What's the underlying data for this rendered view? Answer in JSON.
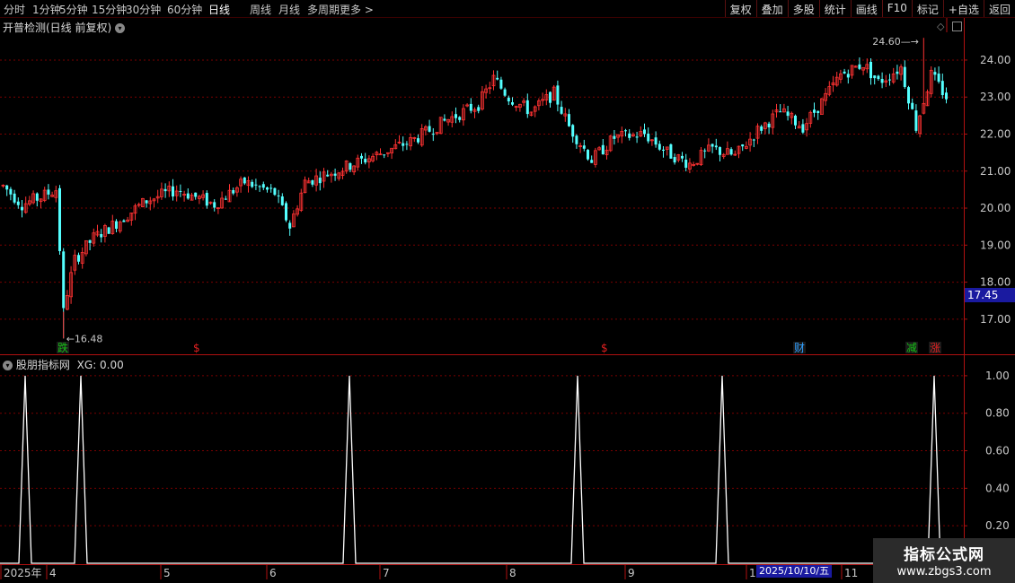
{
  "toolbar": {
    "periods": [
      "分时",
      "1分钟",
      "5分钟",
      "15分钟",
      "30分钟",
      "60分钟",
      "日线",
      "周线",
      "月线",
      "多周期",
      "更多 >"
    ],
    "active": "日线",
    "right_buttons": [
      "复权",
      "叠加",
      "多股",
      "统计",
      "画线",
      "F10",
      "标记",
      "+自选",
      "返回"
    ]
  },
  "main_panel": {
    "title": "开普检测(日线 前复权)",
    "price_axis": [
      "24.00",
      "23.00",
      "22.00",
      "21.00",
      "20.00",
      "19.00",
      "18.00",
      "17.00"
    ],
    "current_price": "17.45",
    "high_label": "24.60",
    "low_label": "16.48",
    "markers": [
      {
        "text": "跌",
        "color": "#16c016"
      },
      {
        "text": "$",
        "color": "#e02020"
      },
      {
        "text": "$",
        "color": "#e02020"
      },
      {
        "text": "财",
        "color": "#30a0ff"
      },
      {
        "text": "减",
        "color": "#16c016"
      },
      {
        "text": "涨",
        "color": "#e02020"
      }
    ]
  },
  "indicator_panel": {
    "title": "股朋指标网",
    "value_label": "XG: 0.00",
    "axis": [
      "1.00",
      "0.80",
      "0.60",
      "0.40",
      "0.20"
    ]
  },
  "date_axis": {
    "labels": [
      "2025年",
      "4",
      "5",
      "6",
      "7",
      "8",
      "9",
      "1",
      "11"
    ],
    "highlight": "2025/10/10/五"
  },
  "watermark": {
    "title": "指标公式网",
    "url": "www.zbgs3.com"
  },
  "chart_data": [
    {
      "type": "candlestick",
      "title": "开普检测(日线 前复权)",
      "ylim": [
        16.1,
        24.75
      ],
      "y_ticks": [
        17,
        18,
        19,
        20,
        21,
        22,
        23,
        24
      ],
      "high": 24.6,
      "low": 16.48,
      "last": 17.45,
      "trend_path": [
        [
          0,
          20.6
        ],
        [
          5,
          20.1
        ],
        [
          10,
          20.3
        ],
        [
          14,
          20.5
        ],
        [
          16,
          17.3
        ],
        [
          19,
          18.6
        ],
        [
          24,
          19.2
        ],
        [
          30,
          19.6
        ],
        [
          38,
          20.2
        ],
        [
          46,
          20.5
        ],
        [
          56,
          20.1
        ],
        [
          64,
          20.7
        ],
        [
          72,
          20.4
        ],
        [
          76,
          19.5
        ],
        [
          80,
          20.7
        ],
        [
          88,
          21.0
        ],
        [
          98,
          21.4
        ],
        [
          108,
          21.8
        ],
        [
          118,
          22.4
        ],
        [
          126,
          22.8
        ],
        [
          130,
          23.5
        ],
        [
          134,
          23.0
        ],
        [
          140,
          22.6
        ],
        [
          146,
          23.1
        ],
        [
          150,
          22.2
        ],
        [
          156,
          21.3
        ],
        [
          162,
          21.9
        ],
        [
          170,
          22.0
        ],
        [
          176,
          21.5
        ],
        [
          182,
          21.2
        ],
        [
          188,
          21.6
        ],
        [
          194,
          21.4
        ],
        [
          200,
          22.1
        ],
        [
          206,
          22.6
        ],
        [
          212,
          22.2
        ],
        [
          218,
          23.0
        ],
        [
          222,
          23.6
        ],
        [
          228,
          23.9
        ],
        [
          232,
          23.4
        ],
        [
          238,
          23.8
        ],
        [
          242,
          22.2
        ],
        [
          246,
          23.6
        ],
        [
          250,
          23.0
        ]
      ]
    },
    {
      "type": "line",
      "title": "股朋指标网",
      "ylim": [
        0,
        1.1
      ],
      "y_ticks": [
        0.2,
        0.4,
        0.6,
        0.8,
        1.0
      ],
      "spikes_at_x": [
        28,
        90,
        389,
        643,
        804,
        1040
      ],
      "spike_value": 1.0,
      "baseline": 0.0
    }
  ]
}
